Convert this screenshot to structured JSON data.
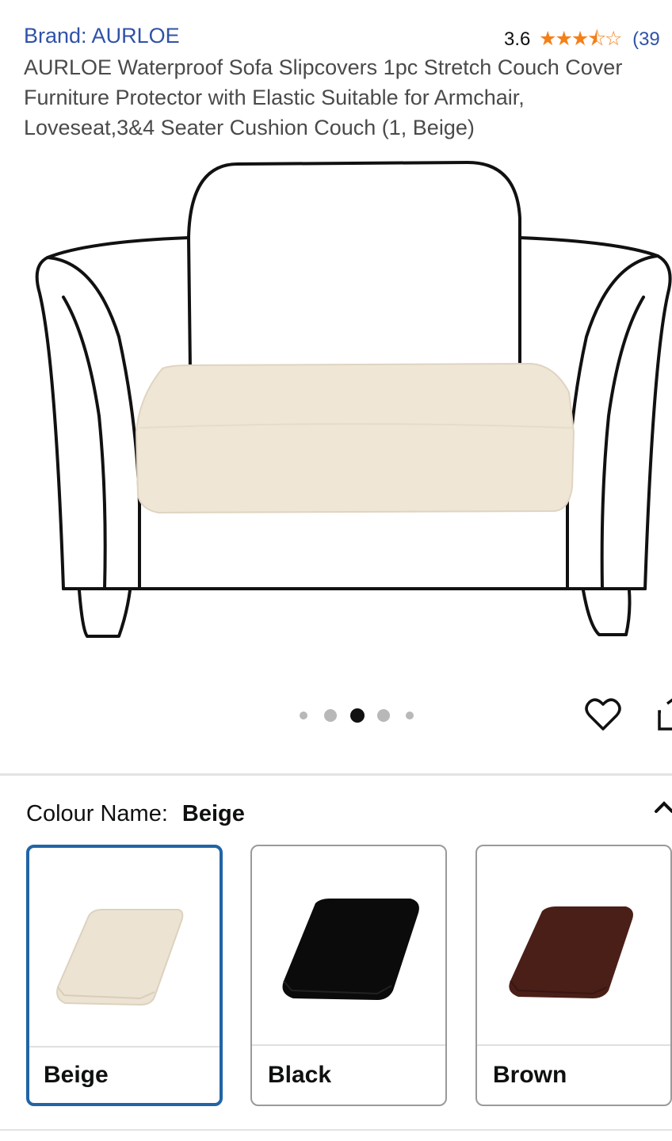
{
  "product": {
    "brand": "Brand: AURLOE",
    "rating": "3.6",
    "stars": {
      "value": 3.5,
      "max": 5
    },
    "review_count": "(39",
    "title_lines": [
      "AURLOE Waterproof Sofa Slipcovers 1pc Stretch Couch Cover",
      "Furniture Protector with Elastic Suitable for Armchair,",
      "Loveseat,3&4 Seater Cushion Couch (1, Beige)"
    ]
  },
  "gallery": {
    "image_count": 5,
    "active_index": 2
  },
  "variation": {
    "label": "Colour Name:",
    "selected": "Beige",
    "options": [
      {
        "label": "Beige",
        "color": "#ece3d3"
      },
      {
        "label": "Black",
        "color": "#0b0b0b"
      },
      {
        "label": "Brown",
        "color": "#4a1f18"
      }
    ]
  },
  "colors": {
    "link": "#2f52a8",
    "star": "#f57f17",
    "selected_border": "#2164a6",
    "cushion": "#efe6d6"
  }
}
